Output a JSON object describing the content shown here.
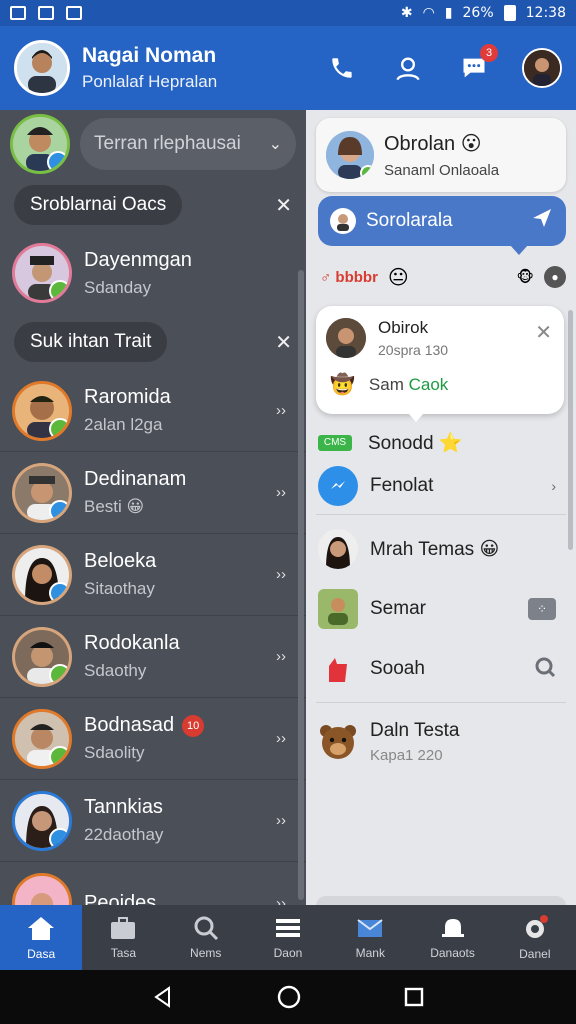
{
  "status_bar": {
    "time": "12:38",
    "icons_left": [
      "photo-icon",
      "gmail-icon",
      "image-icon"
    ],
    "icons_right": [
      "bluetooth-icon",
      "wifi-icon",
      "signal-icon",
      "battery-icon"
    ],
    "network": "26%"
  },
  "header": {
    "name": "Nagai Noman",
    "subtitle": "Ponlalaf Hepralan",
    "notification_count": "3"
  },
  "search": {
    "placeholder": "Terran rlephausai"
  },
  "sections": [
    {
      "label": "Sroblarnai Oacs"
    },
    {
      "label": "Suk ihtan Trait"
    }
  ],
  "contacts": [
    {
      "name": "Dayenmgan",
      "sub": "Sdanday",
      "ring": "#e27a9a",
      "status": "green"
    },
    {
      "name": "Raromida",
      "sub": "2alan l2ga",
      "ring": "#e07a2a",
      "status": "green"
    },
    {
      "name": "Dedinanam",
      "sub": "Besti 😀",
      "ring": "#e07a2a",
      "status": "blue"
    },
    {
      "name": "Beloeka",
      "sub": "Sitaothay",
      "ring": "#e07a2a",
      "status": "blue"
    },
    {
      "name": "Rodokanla",
      "sub": "Sdaothy",
      "ring": "#e07a2a",
      "status": "green"
    },
    {
      "name": "Bodnasad",
      "sub": "Sdaolity",
      "ring": "#e07a2a",
      "status": "green",
      "badge": "10"
    },
    {
      "name": "Tannkias",
      "sub": "22daothay",
      "ring": "#2a7ad8",
      "status": "blue"
    },
    {
      "name": "Peoides",
      "sub": "",
      "ring": "#e07a2a",
      "status": ""
    }
  ],
  "right_panel": {
    "top_card": {
      "title": "Obrolan 😮",
      "sub": "Sanaml Onlaoala"
    },
    "send_pill": {
      "label": "Sorolarala"
    },
    "reaction_row": {
      "tag": "♂ bbbbr"
    },
    "popup": {
      "name": "Obirok",
      "sub": "20spra 130",
      "line_prefix": "Sam ",
      "line_green": "Caok"
    },
    "items": [
      {
        "name": "Sonodd ⭐",
        "sub": "",
        "chip": "CMS"
      },
      {
        "name": "Fenolat",
        "sub": ""
      },
      {
        "name": "Mrah Temas 😀",
        "sub": ""
      },
      {
        "name": "Semar",
        "sub": ""
      },
      {
        "name": "Sooah",
        "sub": ""
      },
      {
        "name": "Daln Testa",
        "sub": "Kapa1 220"
      }
    ]
  },
  "bottom_nav": [
    {
      "label": "Dasa",
      "icon": "home-icon",
      "active": true
    },
    {
      "label": "Tasa",
      "icon": "briefcase-icon"
    },
    {
      "label": "Nems",
      "icon": "search-people-icon"
    },
    {
      "label": "Daon",
      "icon": "list-icon"
    },
    {
      "label": "Mank",
      "icon": "mail-icon"
    },
    {
      "label": "Danaots",
      "icon": "bell-icon"
    },
    {
      "label": "Danel",
      "icon": "settings-icon"
    }
  ],
  "colors": {
    "brand": "#2563c4",
    "left_bg": "#4b4f58",
    "right_bg": "#e6e7ea",
    "online": "#5cb83a",
    "badge": "#d83b30"
  }
}
